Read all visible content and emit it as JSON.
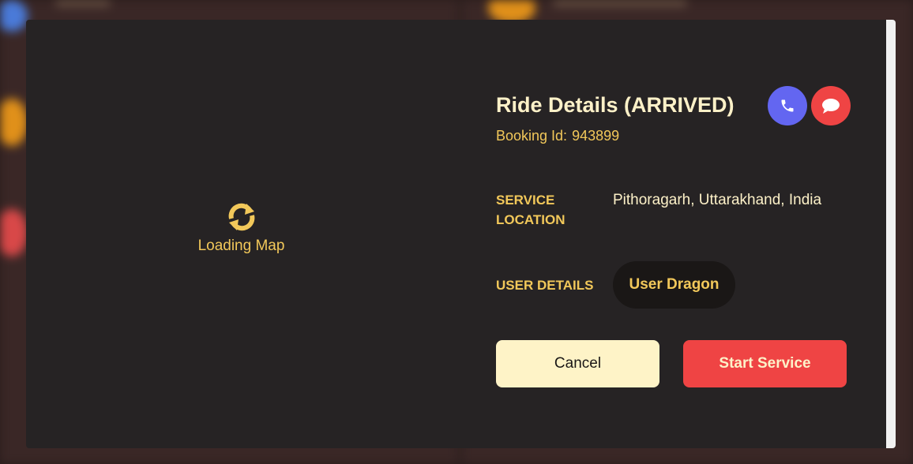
{
  "modal": {
    "map": {
      "loading_text": "Loading Map",
      "loading_icon": "refresh-icon"
    },
    "title": "Ride Details (ARRIVED)",
    "booking_label": "Booking Id:",
    "booking_id": "943899",
    "service_location_label": "SERVICE LOCATION",
    "service_location_value": "Pithoragarh, Uttarakhand, India",
    "user_details_label": "USER DETAILS",
    "user_name": "User Dragon",
    "cancel_label": "Cancel",
    "start_label": "Start Service",
    "icons": {
      "call": "phone-icon",
      "chat": "chat-icon"
    }
  },
  "colors": {
    "modal_bg": "#262324",
    "accent_yellow": "#f2c85a",
    "cream": "#fdf1c8",
    "call_blue": "#6366f1",
    "danger_red": "#ef4444"
  }
}
